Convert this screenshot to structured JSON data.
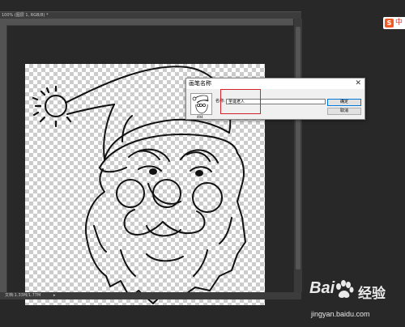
{
  "document": {
    "tab_title": "100% (图层 1, RGB/8) *",
    "status_text": "文档:1.33M/1.77M",
    "status_arrow": "▸"
  },
  "ime": {
    "logo": "S",
    "char": "中"
  },
  "dialog": {
    "title": "画笔名称",
    "close_glyph": "✕",
    "brush_size": "494",
    "name_label": "名称:",
    "name_value": "圣诞老人",
    "ok_label": "确定",
    "cancel_label": "取消"
  },
  "watermark": {
    "logo": "Bai",
    "brand": "经验",
    "url": "jingyan.baidu.com"
  },
  "colors": {
    "workspace": "#282828",
    "highlight": "#d2232a",
    "ime_orange": "#f15a24"
  }
}
